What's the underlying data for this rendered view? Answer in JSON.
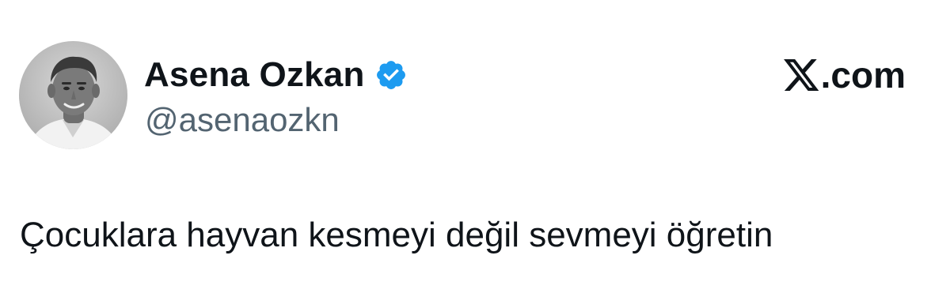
{
  "tweet": {
    "author": {
      "display_name": "Asena Ozkan",
      "handle": "@asenaozkn",
      "verified": true,
      "avatar_icon": "profile-photo",
      "badge_color": "#1d9bf0"
    },
    "brand": {
      "logo_icon": "x-logo-icon",
      "domain_suffix": ".com"
    },
    "text": "Çocuklara hayvan kesmeyi değil sevmeyi öğretin"
  },
  "colors": {
    "text_primary": "#0f1419",
    "text_secondary": "#536471",
    "background": "#ffffff"
  }
}
